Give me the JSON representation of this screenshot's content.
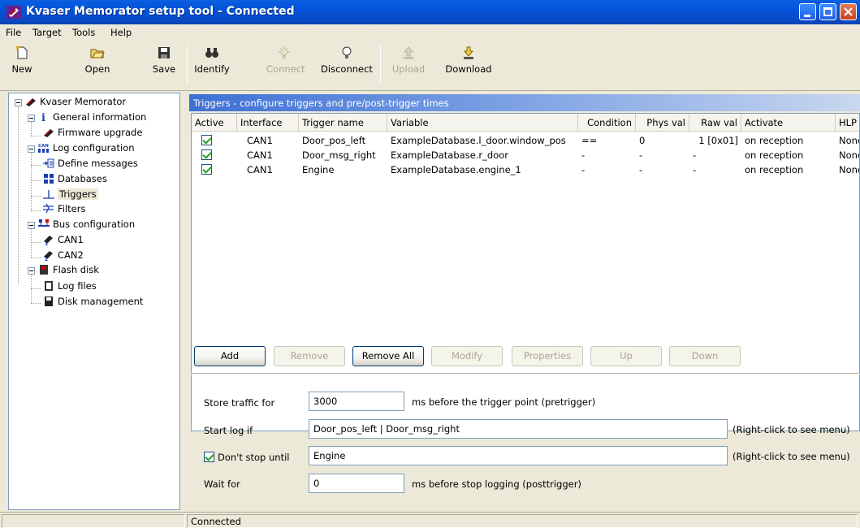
{
  "window": {
    "title": "Kvaser Memorator setup tool - Connected"
  },
  "menu": [
    "File",
    "Target",
    "Tools",
    "Help"
  ],
  "toolbar": {
    "new": "New",
    "open": "Open",
    "save": "Save",
    "identify": "Identify",
    "connect": "Connect",
    "disconnect": "Disconnect",
    "upload": "Upload",
    "download": "Download"
  },
  "tree": {
    "root": "Kvaser Memorator",
    "general_information": "General information",
    "firmware_upgrade": "Firmware upgrade",
    "log_configuration": "Log configuration",
    "define_messages": "Define messages",
    "databases": "Databases",
    "triggers": "Triggers",
    "filters": "Filters",
    "bus_configuration": "Bus configuration",
    "can1": "CAN1",
    "can2": "CAN2",
    "flash_disk": "Flash disk",
    "log_files": "Log files",
    "disk_management": "Disk management"
  },
  "panel": {
    "header": "Triggers - configure triggers and pre/post-trigger times"
  },
  "table": {
    "columns": [
      "Active",
      "Interface",
      "Trigger name",
      "Variable",
      "Condition",
      "Phys val",
      "Raw val",
      "Activate",
      "HLP"
    ],
    "rows": [
      {
        "active": true,
        "interface": "CAN1",
        "name": "Door_pos_left",
        "variable": "ExampleDatabase.l_door.window_pos",
        "condition": "==",
        "phys": "0",
        "raw": "1 [0x01]",
        "activate": "on reception",
        "hlp": "None"
      },
      {
        "active": true,
        "interface": "CAN1",
        "name": "Door_msg_right",
        "variable": "ExampleDatabase.r_door",
        "condition": "-",
        "phys": "-",
        "raw": "-",
        "activate": "on reception",
        "hlp": "None"
      },
      {
        "active": true,
        "interface": "CAN1",
        "name": "Engine",
        "variable": "ExampleDatabase.engine_1",
        "condition": "-",
        "phys": "-",
        "raw": "-",
        "activate": "on reception",
        "hlp": "None"
      }
    ]
  },
  "buttons": {
    "add": "Add",
    "remove": "Remove",
    "remove_all": "Remove All",
    "modify": "Modify",
    "properties": "Properties",
    "up": "Up",
    "down": "Down"
  },
  "form": {
    "store_label": "Store traffic for",
    "store_value": "3000",
    "store_hint": "ms before the trigger point (pretrigger)",
    "start_label": "Start log if",
    "start_value": "Door_pos_left | Door_msg_right",
    "start_hint": "(Right-click to see menu)",
    "stop_label": "Don't stop until",
    "stop_checked": true,
    "stop_value": "Engine",
    "stop_hint": "(Right-click to see menu)",
    "wait_label": "Wait for",
    "wait_value": "0",
    "wait_hint": "ms before stop logging (posttrigger)"
  },
  "status": {
    "text": "Connected"
  }
}
